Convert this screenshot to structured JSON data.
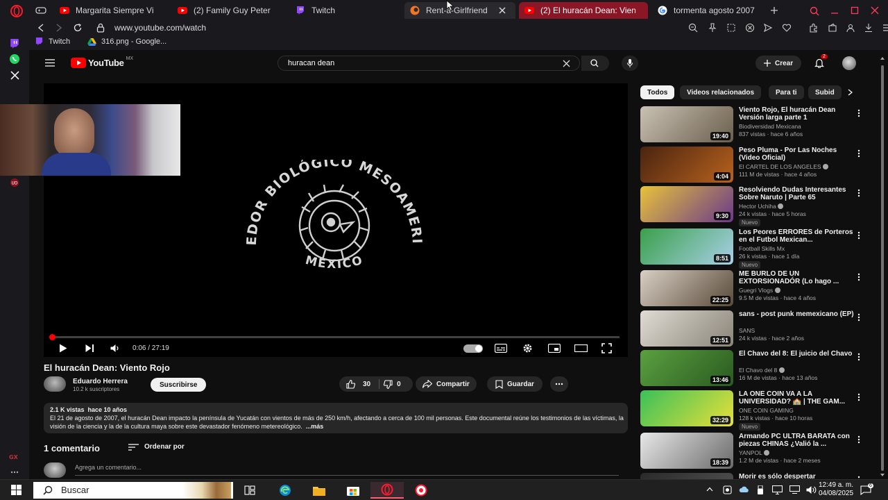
{
  "tabs": [
    {
      "title": "Margarita Siempre Vi",
      "icon": "youtube-icon"
    },
    {
      "title": "(2) Family Guy Peter",
      "icon": "youtube-icon"
    },
    {
      "title": "Twitch",
      "icon": "twitch-icon"
    },
    {
      "title": "Rent-a-Girlfriend",
      "icon": "crunchyroll-icon"
    },
    {
      "title": "(2) El huracán Dean: Vien",
      "icon": "youtube-icon"
    },
    {
      "title": "tormenta agosto 2007",
      "icon": "google-icon"
    }
  ],
  "address": {
    "url": "www.youtube.com/watch"
  },
  "bookmarks": [
    {
      "label": "Twitch",
      "icon": "twitch-icon"
    },
    {
      "label": "316.png - Google...",
      "icon": "google-drive-icon"
    }
  ],
  "youtube": {
    "logo_text": "YouTube",
    "region": "MX",
    "search_query": "huracan dean",
    "create_label": "Crear",
    "notif_count": "2"
  },
  "player": {
    "logo_text_top": "CORREDOR BIOLÓGICO MESOAMERICANO",
    "logo_text_bottom": "MÉXICO",
    "time": "0:06 / 27:19",
    "progress_fraction": 0.004
  },
  "video": {
    "title": "El huracán Dean: Viento Rojo",
    "channel": "Eduardo Herrera",
    "subs": "10.2 k suscriptores",
    "subscribe_label": "Suscribirse",
    "likes": "30",
    "dislikes": "0",
    "share_label": "Compartir",
    "save_label": "Guardar",
    "stats": "2.1 K vistas  hace 10 años",
    "description": "El 21 de agosto de 2007, el huracán Dean impacto la península de Yucatán con vientos de más de 250 km/h, afectando a cerca de 100 mil personas. Este documental reúne los testimonios de las víctimas, la visión de la ciencia y la de la cultura maya sobre este devastador fenómeno metereológico.",
    "more_label": "...más",
    "comments_count": "1 comentario",
    "sort_label": "Ordenar por",
    "comment_placeholder": "Agrega un comentario..."
  },
  "chips": [
    "Todos",
    "Videos relacionados",
    "Para ti",
    "Subid"
  ],
  "recommendations": [
    {
      "title": "Viento Rojo, El huracán Dean Versión larga parte 1",
      "channel": "Biodiversidad Mexicana",
      "meta": "837 vistas · hace 6 años",
      "duration": "19:40",
      "verified": false,
      "badge": "",
      "colors": [
        "#c9c2b4",
        "#6b5e4c"
      ]
    },
    {
      "title": "Peso Pluma - Por Las Noches (Video Oficial)",
      "channel": "El CARTEL DE LOS ANGELES",
      "meta": "111 M de vistas · hace 4 años",
      "duration": "4:04",
      "verified": true,
      "badge": "",
      "colors": [
        "#4a2410",
        "#b8621e"
      ]
    },
    {
      "title": "Resolviendo Dudas Interesantes Sobre Naruto | Parte 65",
      "channel": "Hector Uchiha",
      "meta": "24 k vistas · hace 5 horas",
      "duration": "9:30",
      "verified": true,
      "badge": "Nuevo",
      "colors": [
        "#e8c23a",
        "#6a3a8a"
      ]
    },
    {
      "title": "Los Peores ERRORES de Porteros en el Futbol Mexican...",
      "channel": "Football Skills Mx",
      "meta": "26 k vistas · hace 1 día",
      "duration": "8:51",
      "verified": false,
      "badge": "Nuevo",
      "colors": [
        "#3aa04a",
        "#a8d0e8"
      ]
    },
    {
      "title": "ME BURLO DE UN EXTORSIONADÓR (Lo hago ...",
      "channel": "Guegri Vlogs",
      "meta": "9.5 M de vistas · hace 4 años",
      "duration": "22:25",
      "verified": true,
      "badge": "",
      "colors": [
        "#d8d0c4",
        "#5a4a3a"
      ]
    },
    {
      "title": "sans - post punk memexicano (EP)",
      "channel": "SANS",
      "meta": "24 k vistas · hace 2 años",
      "duration": "12:51",
      "verified": false,
      "badge": "",
      "colors": [
        "#e0dcd4",
        "#8a8478"
      ]
    },
    {
      "title": "El Chavo del 8: El juicio del Chavo",
      "channel": "El Chavo del 8",
      "meta": "16 M de vistas · hace 13 años",
      "duration": "13:46",
      "verified": true,
      "badge": "",
      "colors": [
        "#5aa040",
        "#2a5a20"
      ]
    },
    {
      "title": "LA ONE COIN VA A LA UNIVERSIDAD? 🏫 | THE GAM...",
      "channel": "ONE COIN GAMING",
      "meta": "128 k vistas · hace 10 horas",
      "duration": "32:29",
      "verified": false,
      "badge": "Nuevo",
      "colors": [
        "#3ac05a",
        "#e8e03a"
      ]
    },
    {
      "title": "Armando PC ULTRA BARATA con piezas CHINAS ¿Valió la ...",
      "channel": "YANPOL",
      "meta": "1.2 M de vistas · hace 2 meses",
      "duration": "18:39",
      "verified": true,
      "badge": "",
      "colors": [
        "#e8e8e8",
        "#6a6a6a"
      ]
    },
    {
      "title": "Morir es sólo despertar",
      "channel": "",
      "meta": "",
      "duration": "",
      "verified": false,
      "badge": "",
      "colors": [
        "#2a2a2a",
        "#555555"
      ]
    }
  ],
  "taskbar": {
    "search_placeholder": "Buscar",
    "time": "12:49 a. m.",
    "date": "04/08/2025"
  },
  "colors": {
    "accent": "#ff0000",
    "tab_active": "#8a1626",
    "opera": "#ff1b2d"
  }
}
